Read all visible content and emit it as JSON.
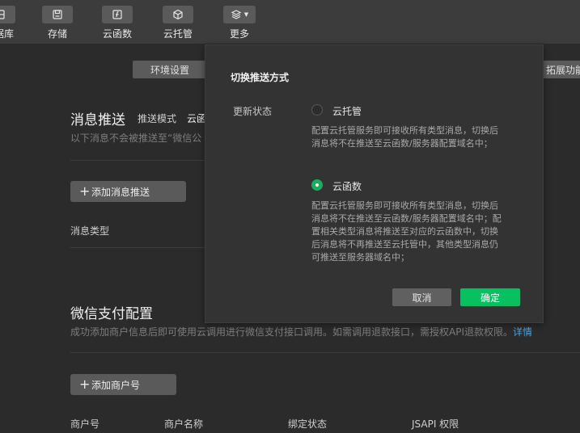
{
  "toolbar": {
    "items": [
      {
        "label": "据库",
        "icon": "database-icon"
      },
      {
        "label": "存储",
        "icon": "storage-icon"
      },
      {
        "label": "云函数",
        "icon": "cloud-function-icon"
      },
      {
        "label": "云托管",
        "icon": "cloud-hosting-icon"
      },
      {
        "label": "更多",
        "icon": "layers-icon"
      }
    ]
  },
  "page": {
    "env_button": "环境设置",
    "ext_button": "拓展功能",
    "message_push": {
      "title": "消息推送",
      "mode_label": "推送模式",
      "mode_value": "云函",
      "desc": "以下消息不会被推送至“微信公",
      "add_button": "添加消息推送",
      "col_type": "消息类型"
    },
    "wxpay": {
      "title": "微信支付配置",
      "desc": "成功添加商户信息后即可使用云调用进行微信支付接口调用。如需调用退款接口，需授权API退款权限。",
      "desc_link": "详情",
      "add_button": "添加商户号",
      "columns": [
        "商户号",
        "商户名称",
        "绑定状态",
        "JSAPI 权限"
      ]
    }
  },
  "modal": {
    "title": "切换推送方式",
    "update_label": "更新状态",
    "options": [
      {
        "label": "云托管",
        "selected": false,
        "desc_lines": [
          "配置云托管服务即可接收所有类型消息，切换后",
          "消息将不在推送至云函数/服务器配置域名中；"
        ]
      },
      {
        "label": "云函数",
        "selected": true,
        "desc_lines": [
          "配置云托管服务即可接收所有类型消息，切换后",
          "消息将不在推送至云函数/服务器配置域名中；配",
          "置相关类型消息将推送至对应的云函数中，切换",
          "后消息将不再推送至云托管中，其他类型消息仍",
          "可推送至服务器域名中；"
        ]
      }
    ],
    "cancel": "取消",
    "confirm": "确定"
  },
  "colors": {
    "accent": "#07c160",
    "link": "#4aa3e0",
    "background": "#2b2b2b",
    "toolbar": "#3c3c3c"
  }
}
